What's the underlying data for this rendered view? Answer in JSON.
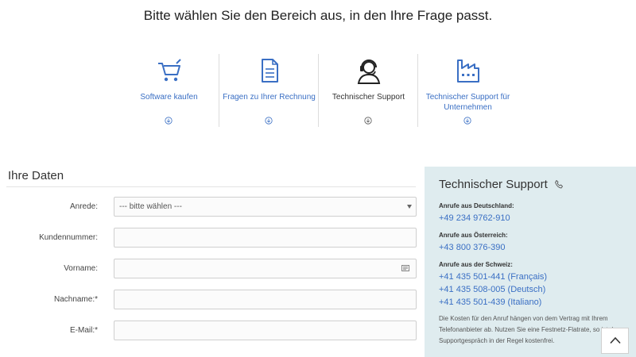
{
  "heading": "Bitte wählen Sie den Bereich aus, in den Ihre Frage passt.",
  "categories": [
    {
      "label": "Software kaufen",
      "icon": "shopping-cart-icon"
    },
    {
      "label": "Fragen zu Ihrer Rechnung",
      "icon": "document-icon"
    },
    {
      "label": "Technischer Support",
      "icon": "headset-support-icon"
    },
    {
      "label": "Technischer Support für Unternehmen",
      "icon": "factory-icon"
    }
  ],
  "form": {
    "title": "Ihre Daten",
    "fields": {
      "salutation": {
        "label": "Anrede:",
        "value": "--- bitte wählen ---"
      },
      "customer_number": {
        "label": "Kundennummer:",
        "value": ""
      },
      "first_name": {
        "label": "Vorname:",
        "value": ""
      },
      "last_name": {
        "label": "Nachname:*",
        "value": ""
      },
      "email": {
        "label": "E-Mail:*",
        "value": ""
      }
    }
  },
  "panel": {
    "title": "Technischer Support",
    "de_label": "Anrufe aus Deutschland:",
    "de_number": "+49 234 9762-910",
    "at_label": "Anrufe aus Österreich:",
    "at_number": "+43 800 376-390",
    "ch_label": "Anrufe aus der Schweiz:",
    "ch_numbers": [
      "+41 435 501-441 (Français)",
      "+41 435 508-005 (Deutsch)",
      "+41 435 501-439 (Italiano)"
    ],
    "note": "Die Kosten für den Anruf hängen von dem Vertrag mit Ihrem Telefonanbieter ab. Nutzen Sie eine Festnetz-Flatrate, so ist das Supportgespräch in der Regel kostenfrei."
  },
  "colors": {
    "accent": "#3a6fc4",
    "panel_bg": "#dfecef"
  }
}
